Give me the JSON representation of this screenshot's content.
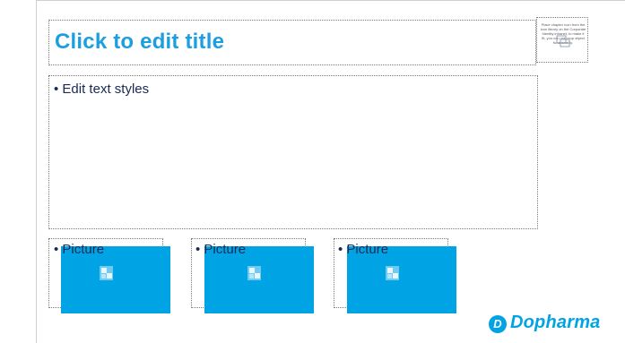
{
  "slide": {
    "title_placeholder": "Click to edit title",
    "body_placeholder": "• Edit text styles",
    "icon_placeholder_note": "Place chapter icon from the icon library on the Corporate Identity intranet, to make it fit, you can use crop object functionality.",
    "picture_placeholders": [
      {
        "label": "• Picture"
      },
      {
        "label": "• Picture"
      },
      {
        "label": "• Picture"
      }
    ]
  },
  "brand": {
    "logo_text": "Dopharma",
    "logo_mark": "D",
    "accent_color": "#00a4e4",
    "title_color": "#1c9fe0",
    "text_color": "#1b2a55"
  },
  "icons": {
    "picture_placeholder_icon": "picture-icon",
    "chapter_icon_placeholder": "chapter-icon"
  }
}
